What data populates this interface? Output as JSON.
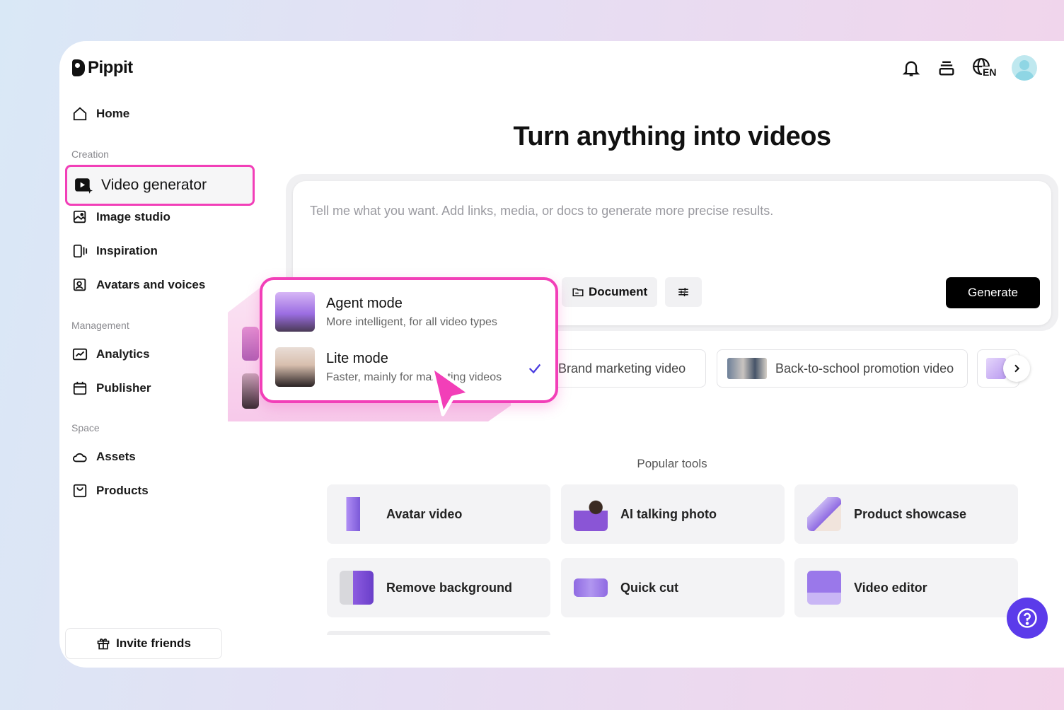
{
  "app": {
    "name": "Pippit"
  },
  "sidebar": {
    "home": "Home",
    "creation_label": "Creation",
    "video_generator": "Video generator",
    "image_studio": "Image studio",
    "inspiration": "Inspiration",
    "avatars_voices": "Avatars and voices",
    "management_label": "Management",
    "analytics": "Analytics",
    "publisher": "Publisher",
    "space_label": "Space",
    "assets": "Assets",
    "products": "Products",
    "invite": "Invite friends"
  },
  "header": {
    "language": "EN"
  },
  "main": {
    "title": "Turn anything into videos",
    "prompt_placeholder": "Tell me what you want. Add links, media, or docs to generate more precise results.",
    "document_button": "Document",
    "generate_button": "Generate",
    "suggestions": [
      "Brand marketing video",
      "Back-to-school promotion video"
    ],
    "popular_title": "Popular tools",
    "tools": [
      "Avatar video",
      "AI talking photo",
      "Product showcase",
      "Remove background",
      "Quick cut",
      "Video editor"
    ]
  },
  "mode_menu": {
    "agent_title": "Agent mode",
    "agent_desc": "More intelligent, for all video types",
    "lite_title": "Lite mode",
    "lite_desc": "Faster, mainly for marketing videos",
    "selected": "Lite mode"
  },
  "colors": {
    "accent_pink": "#f23fb8",
    "brand_purple": "#5b3bea",
    "primary_button": "#000000"
  },
  "icons": [
    "home-icon",
    "video-generator-icon",
    "image-studio-icon",
    "inspiration-icon",
    "avatars-icon",
    "analytics-icon",
    "publisher-icon",
    "assets-icon",
    "products-icon",
    "gift-icon",
    "bell-icon",
    "layers-icon",
    "globe-icon",
    "folder-icon",
    "sliders-icon",
    "chevron-right-icon",
    "help-icon",
    "check-icon",
    "cursor-icon"
  ]
}
